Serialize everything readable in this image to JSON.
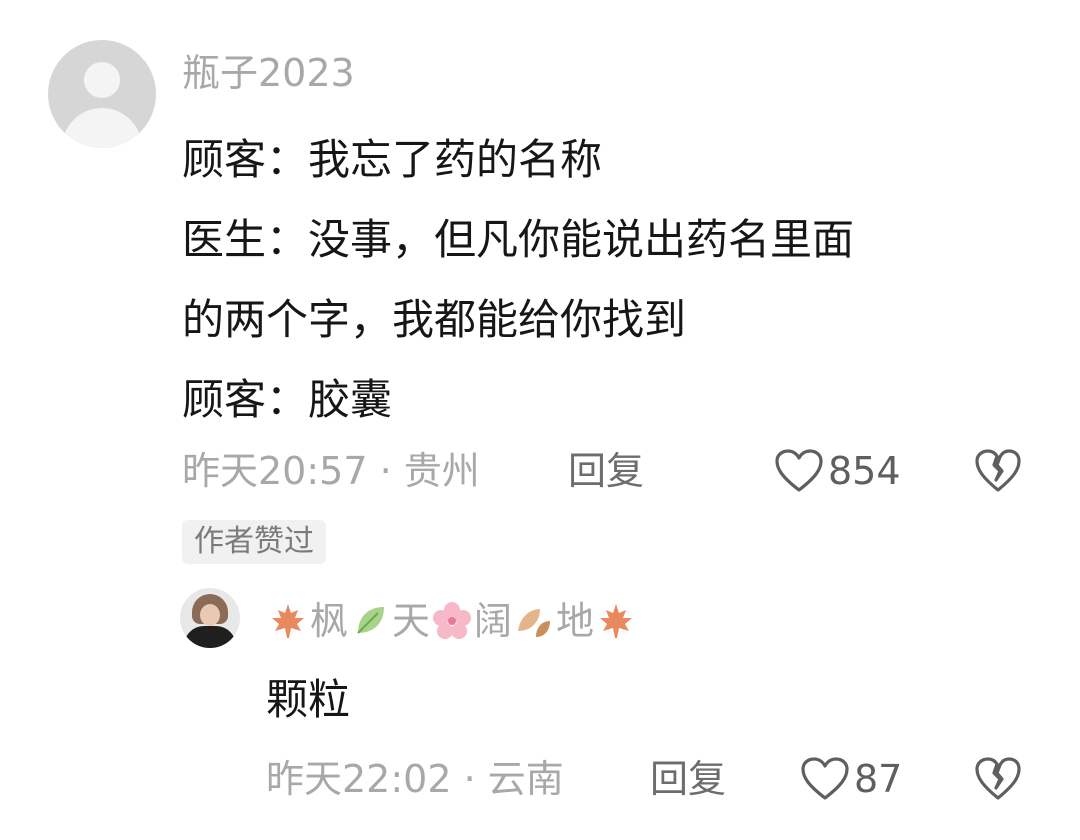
{
  "comment": {
    "username": "瓶子2023",
    "lines": [
      "顾客：我忘了药的名称",
      "医生：没事，但凡你能说出药名里面",
      "的两个字，我都能给你找到",
      "顾客：胶囊"
    ],
    "time_location": "昨天20:57 · 贵州",
    "reply_label": "回复",
    "like_count": "854",
    "author_liked_badge": "作者赞过"
  },
  "reply": {
    "username_parts": [
      "枫",
      "天",
      "阔",
      "地"
    ],
    "text": "颗粒",
    "time_location": "昨天22:02 · 云南",
    "reply_label": "回复",
    "like_count": "87"
  },
  "icons": {
    "like": "heart-outline-icon",
    "dislike": "broken-heart-icon",
    "emoji": [
      "maple-leaf-icon",
      "green-leaf-icon",
      "cherry-blossom-icon",
      "autumn-leaves-icon",
      "maple-leaf-icon"
    ]
  },
  "colors": {
    "text_primary": "#161616",
    "text_secondary": "#a8a8a8",
    "badge_bg": "#f1f1f1"
  }
}
